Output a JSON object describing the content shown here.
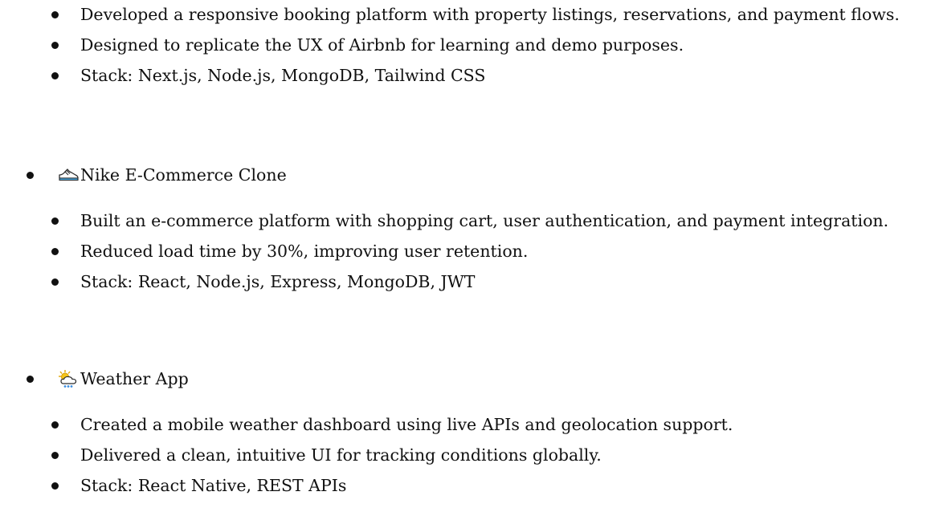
{
  "projects": [
    {
      "title": "",
      "icon": "",
      "points": [
        "Developed a responsive booking platform with property listings, reservations, and payment flows.",
        "Designed to replicate the UX of Airbnb for learning and demo purposes.",
        "Stack: Next.js, Node.js, MongoDB, Tailwind CSS"
      ]
    },
    {
      "title": "Nike E-Commerce Clone",
      "icon": "sneaker-icon",
      "points": [
        "Built an e-commerce platform with shopping cart, user authentication, and payment integration.",
        "Reduced load time by 30%, improving user retention.",
        "Stack: React, Node.js, Express, MongoDB, JWT"
      ]
    },
    {
      "title": "Weather App",
      "icon": "sun-behind-rain-cloud-icon",
      "points": [
        "Created a mobile weather dashboard using live APIs and geolocation support.",
        "Delivered a clean, intuitive UI for tracking conditions globally.",
        "Stack: React Native, REST APIs"
      ]
    }
  ]
}
